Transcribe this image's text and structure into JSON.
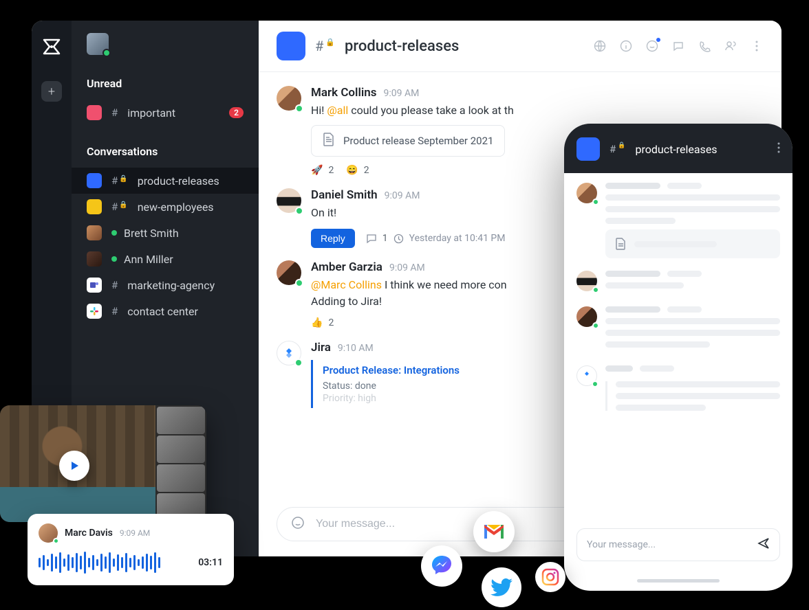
{
  "sidebar": {
    "unread_title": "Unread",
    "conversations_title": "Conversations",
    "unread": [
      {
        "name": "important",
        "badge": "2",
        "chip_color": "#f0506e",
        "has_lock": false
      }
    ],
    "conversations": [
      {
        "name": "product-releases",
        "chip_color": "#2f69ff",
        "type": "channel",
        "has_lock": true,
        "active": true
      },
      {
        "name": "new-employees",
        "chip_color": "#f5c518",
        "type": "channel",
        "has_lock": true
      },
      {
        "name": "Brett Smith",
        "type": "dm",
        "avatar": "av-brett",
        "presence": true
      },
      {
        "name": "Ann Miller",
        "type": "dm",
        "avatar": "av-ann",
        "presence": true
      },
      {
        "name": "marketing-agency",
        "type": "external",
        "icon": "teams"
      },
      {
        "name": "contact center",
        "type": "external",
        "icon": "slack"
      }
    ]
  },
  "header": {
    "channel": "product-releases"
  },
  "messages": [
    {
      "author": "Mark Collins",
      "time": "9:09 AM",
      "avatar": "av-mark",
      "text_pre": "Hi! ",
      "mention": "@all",
      "text_post": " could you please take a look at th",
      "attachment": "Product release September 2021",
      "reactions": [
        {
          "emoji": "🚀",
          "count": "2"
        },
        {
          "emoji": "😄",
          "count": "2"
        }
      ]
    },
    {
      "author": "Daniel Smith",
      "time": "9:09 AM",
      "avatar": "av-daniel",
      "text": "On it!",
      "reply_label": "Reply",
      "thread_count": "1",
      "thread_time": "Yesterday at 10:41 PM"
    },
    {
      "author": "Amber Garzia",
      "time": "9:09 AM",
      "avatar": "av-amber",
      "mention": "@Marc Collins",
      "text_post": " I think we need more con",
      "line2": "Adding to Jira!",
      "reactions": [
        {
          "emoji": "👍",
          "count": "2"
        }
      ]
    },
    {
      "author": "Jira",
      "time": "9:10 AM",
      "avatar": "av-jira",
      "is_jira": true,
      "jira_title": "Product Release: Integrations",
      "jira_status": "Status: done",
      "jira_priority": "Priority: high"
    }
  ],
  "composer": {
    "placeholder": "Your message..."
  },
  "mobile": {
    "channel": "product-releases",
    "composer_placeholder": "Your message..."
  },
  "voice": {
    "name": "Marc Davis",
    "time": "9:09 AM",
    "duration": "03:11"
  }
}
